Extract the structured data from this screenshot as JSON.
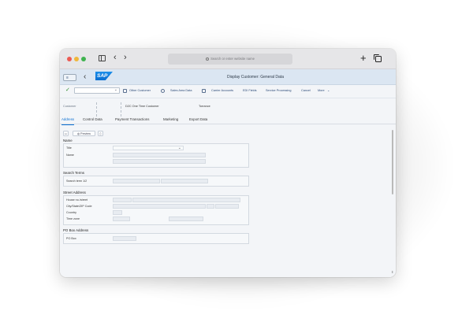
{
  "browser": {
    "url_placeholder": "Search or enter website name"
  },
  "shell": {
    "title": "Display Customer: General Data",
    "logo_text": "SAP"
  },
  "toolbar": {
    "items": [
      "Other Customer",
      "Sales Area Data",
      "Carrier Accounts",
      "EDI Fields",
      "Service Processing",
      "Cancel",
      "More"
    ]
  },
  "header": {
    "customer_label": "Customer",
    "customer_value": "D2C One Time Customer",
    "city_value": "Torrance"
  },
  "tabs": [
    "Address",
    "Control Data",
    "Payment Transactions",
    "Marketing",
    "Export Data"
  ],
  "mini_toolbar": {
    "preview_label": "Preview"
  },
  "sections": {
    "name": {
      "title": "Name",
      "title_label": "Title",
      "name_label": "Name"
    },
    "search_terms": {
      "title": "Search Terms",
      "search_term_label": "Search term 1/2"
    },
    "street_address": {
      "title": "Street Address",
      "house_label": "House no./street",
      "city_label": "City/State/ZIP Code",
      "country_label": "Country",
      "timezone_label": "Time zone"
    },
    "po_box": {
      "title": "PO Box Address",
      "po_box_label": "PO Box"
    }
  }
}
